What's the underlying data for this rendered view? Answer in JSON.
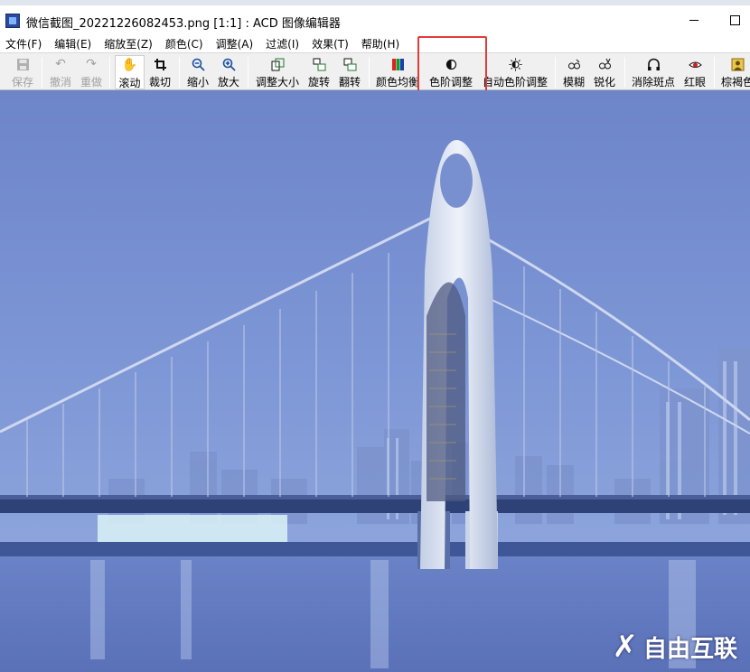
{
  "window": {
    "title": "微信截图_20221226082453.png [1:1] : ACD 图像编辑器",
    "minimize_icon": "minimize-icon",
    "maximize_icon": "maximize-icon"
  },
  "menu": [
    {
      "label": "文件(F)"
    },
    {
      "label": "编辑(E)"
    },
    {
      "label": "缩放至(Z)"
    },
    {
      "label": "颜色(C)"
    },
    {
      "label": "调整(A)"
    },
    {
      "label": "过滤(I)"
    },
    {
      "label": "效果(T)"
    },
    {
      "label": "帮助(H)"
    }
  ],
  "toolbar": {
    "save": {
      "label": "保存",
      "icon": "save-icon"
    },
    "undo": {
      "label": "撤消",
      "icon": "undo-icon"
    },
    "redo": {
      "label": "重做",
      "icon": "redo-icon"
    },
    "scroll": {
      "label": "滚动",
      "icon": "hand-icon"
    },
    "crop": {
      "label": "裁切",
      "icon": "crop-icon"
    },
    "zoom_out": {
      "label": "缩小",
      "icon": "zoom-out-icon"
    },
    "zoom_in": {
      "label": "放大",
      "icon": "zoom-in-icon"
    },
    "resize": {
      "label": "调整大小",
      "icon": "resize-icon"
    },
    "rotate": {
      "label": "旋转",
      "icon": "rotate-icon"
    },
    "flip": {
      "label": "翻转",
      "icon": "flip-icon"
    },
    "equalize": {
      "label": "颜色均衡",
      "icon": "color-balance-icon"
    },
    "levels": {
      "label": "色阶调整",
      "icon": "levels-icon"
    },
    "auto_levels": {
      "label": "自动色阶调整",
      "icon": "auto-levels-icon"
    },
    "blur": {
      "label": "模糊",
      "icon": "blur-icon"
    },
    "sharpen": {
      "label": "锐化",
      "icon": "sharpen-icon"
    },
    "remove_spots": {
      "label": "消除斑点",
      "icon": "remove-spots-icon"
    },
    "red_eye": {
      "label": "红眼",
      "icon": "red-eye-icon"
    },
    "sepia": {
      "label": "棕褐色",
      "icon": "sepia-icon"
    }
  },
  "watermark": {
    "text": "自由互联"
  },
  "colors": {
    "highlight": "#e23b3b",
    "sky": "#6e86c8",
    "water": "#5f77bd"
  }
}
